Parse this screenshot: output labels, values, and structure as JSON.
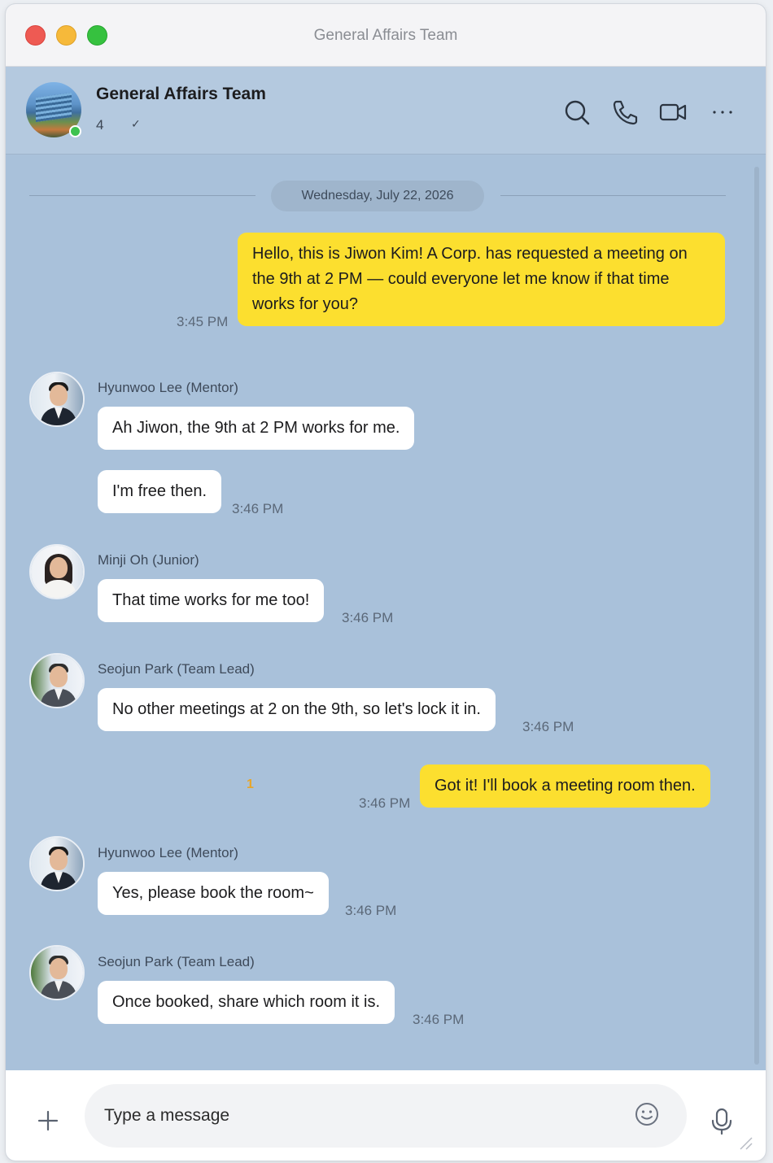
{
  "window": {
    "title": "General Affairs Team"
  },
  "header": {
    "chat_name": "General Affairs Team",
    "member_count": "4",
    "member_chevron": "✓",
    "icons": [
      "search-icon",
      "phone-icon",
      "video-icon",
      "more-icon"
    ]
  },
  "date_divider": "Wednesday, July 22, 2026",
  "messages": [
    {
      "from": "me",
      "text": "Hello, this is Jiwon Kim! A Corp. has requested a meeting on the 9th at 2 PM — could everyone let me know if that time works for you?",
      "time": "3:45 PM"
    },
    {
      "from": "Hyunwoo Lee (Mentor)",
      "text": "Ah Jiwon, the 9th at 2 PM works for me."
    },
    {
      "from": "Hyunwoo Lee (Mentor)",
      "text": "I'm free then.",
      "time": "3:46 PM"
    },
    {
      "from": "Minji Oh (Junior)",
      "text": "That time works for me too!",
      "time": "3:46 PM"
    },
    {
      "from": "Seojun Park (Team Lead)",
      "text": "No other meetings at 2 on the 9th, so let's lock it in.",
      "time": "3:46 PM"
    },
    {
      "from": "me",
      "text": "Got it! I'll book a meeting room then.",
      "time": "3:46 PM",
      "unread": "1"
    },
    {
      "from": "Hyunwoo Lee (Mentor)",
      "text": "Yes, please book the room~",
      "time": "3:46 PM"
    },
    {
      "from": "Seojun Park (Team Lead)",
      "text": "Once booked, share which room it is.",
      "time": "3:46 PM"
    }
  ],
  "composer": {
    "placeholder": "Type a message"
  },
  "colors": {
    "chat_bg": "#a9c1da",
    "my_bubble": "#fcdf2f",
    "their_bubble": "#ffffff",
    "online": "#3dc24f"
  }
}
